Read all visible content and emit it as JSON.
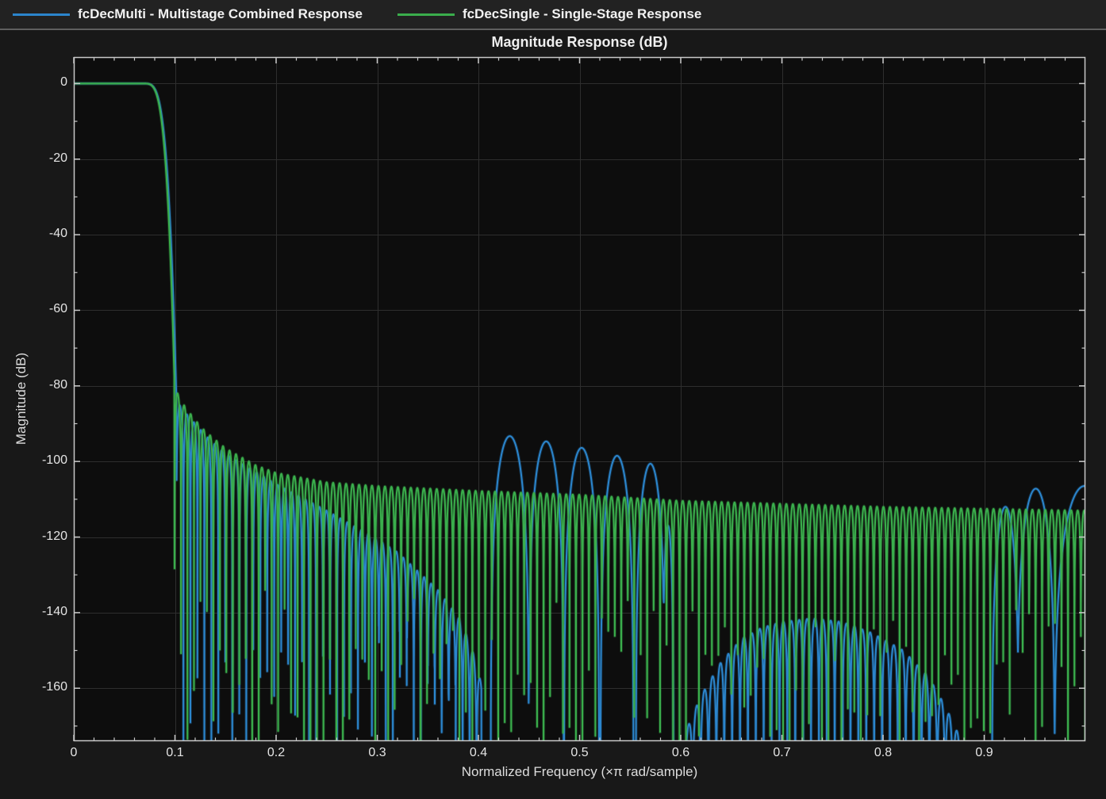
{
  "legend": {
    "items": [
      {
        "label": "fcDecMulti - Multistage Combined Response",
        "color": "#2b85cc"
      },
      {
        "label": "fcDecSingle - Single-Stage Response",
        "color": "#3aae4c"
      }
    ]
  },
  "colors": {
    "figure_bg": "#181818",
    "plot_bg": "#0d0d0d",
    "grid": "#2e2e2e",
    "axis": "#c8c8c8",
    "tick_text": "#e4e4e4",
    "title_text": "#efefef",
    "legend_bg": "#222222",
    "legend_border": "#5f5f5f",
    "legend_text": "#f2f2f2"
  },
  "chart_data": {
    "type": "line",
    "title": "Magnitude Response (dB)",
    "xlabel": "Normalized Frequency (×π rad/sample)",
    "ylabel": "Magnitude (dB)",
    "xlim": [
      0,
      1
    ],
    "ylim": [
      -174,
      7
    ],
    "xticks": [
      0,
      0.1,
      0.2,
      0.3,
      0.4,
      0.5,
      0.6,
      0.7,
      0.8,
      0.9
    ],
    "xtick_labels": [
      "0",
      "0.1",
      "0.2",
      "0.3",
      "0.4",
      "0.5",
      "0.6",
      "0.7",
      "0.8",
      "0.9"
    ],
    "yticks": [
      0,
      -20,
      -40,
      -60,
      -80,
      -100,
      -120,
      -140,
      -160
    ],
    "ytick_labels": [
      "0",
      "-20",
      "-40",
      "-60",
      "-80",
      "-100",
      "-120",
      "-140",
      "-160"
    ],
    "x_minor_step": 0.02,
    "y_minor_step": 10,
    "grid": true,
    "legend_position": "top-bar",
    "series": [
      {
        "name": "fcDecMulti - Multistage Combined Response",
        "color": "#2b85cc",
        "seed": 7,
        "model": {
          "passband": {
            "flat_db": 0,
            "flat_end": 0.068,
            "edge": 0.1015,
            "edge_db": -84,
            "shape_pow": 4
          },
          "segments": [
            {
              "type": "comb",
              "start": 0.1015,
              "end": 0.403,
              "period": 0.0069,
              "envelope": [
                [
                  0.1015,
                  -84
                ],
                [
                  0.11,
                  -87
                ],
                [
                  0.13,
                  -93
                ],
                [
                  0.15,
                  -98
                ],
                [
                  0.2,
                  -106
                ],
                [
                  0.25,
                  -113
                ],
                [
                  0.29,
                  -119
                ],
                [
                  0.32,
                  -124
                ],
                [
                  0.34,
                  -129
                ],
                [
                  0.36,
                  -134
                ],
                [
                  0.38,
                  -141
                ],
                [
                  0.393,
                  -149
                ],
                [
                  0.403,
                  -159
                ]
              ],
              "null_floor_range": [
                -140,
                -186
              ]
            },
            {
              "type": "arcs",
              "steepness": 45,
              "arcs": [
                [
                  0.431,
                  0.019,
                  -93.3
                ],
                [
                  0.467,
                  0.0175,
                  -94.7
                ],
                [
                  0.502,
                  0.0175,
                  -96.4
                ],
                [
                  0.537,
                  0.0165,
                  -98.5
                ],
                [
                  0.57,
                  0.0145,
                  -100.6
                ],
                [
                  0.5875,
                  0.0055,
                  -117
                ]
              ]
            },
            {
              "type": "comb",
              "start": 0.604,
              "end": 0.878,
              "period": 0.0078,
              "envelope": [
                [
                  0.604,
                  -172
                ],
                [
                  0.62,
                  -162
                ],
                [
                  0.64,
                  -153
                ],
                [
                  0.66,
                  -147
                ],
                [
                  0.68,
                  -144
                ],
                [
                  0.7,
                  -142.5
                ],
                [
                  0.73,
                  -141.5
                ],
                [
                  0.76,
                  -142.5
                ],
                [
                  0.79,
                  -145.5
                ],
                [
                  0.82,
                  -150
                ],
                [
                  0.845,
                  -157
                ],
                [
                  0.862,
                  -165
                ],
                [
                  0.876,
                  -173
                ]
              ],
              "null_floor_range": [
                -190,
                -190
              ]
            },
            {
              "type": "arcs",
              "steepness": 45,
              "arcs": [
                [
                  0.921,
                  0.0135,
                  -112
                ],
                [
                  0.951,
                  0.019,
                  -107.2
                ],
                [
                  0.999,
                  0.03,
                  -106.5
                ]
              ]
            }
          ]
        }
      },
      {
        "name": "fcDecSingle - Single-Stage Response",
        "color": "#3aae4c",
        "seed": 3,
        "model": {
          "passband": {
            "flat_db": 0,
            "flat_end": 0.068,
            "edge": 0.0996,
            "edge_db": -80,
            "shape_pow": 4
          },
          "segments": [
            {
              "type": "comb",
              "start": 0.0996,
              "end": 1.0,
              "period": 0.0064,
              "envelope": [
                [
                  0.0996,
                  -80
                ],
                [
                  0.105,
                  -83.5
                ],
                [
                  0.11,
                  -85.5
                ],
                [
                  0.12,
                  -89
                ],
                [
                  0.13,
                  -92
                ],
                [
                  0.15,
                  -96.5
                ],
                [
                  0.18,
                  -101
                ],
                [
                  0.2,
                  -103
                ],
                [
                  0.25,
                  -105.5
                ],
                [
                  0.3,
                  -106.5
                ],
                [
                  0.4,
                  -107.8
                ],
                [
                  0.5,
                  -108.8
                ],
                [
                  0.6,
                  -110.4
                ],
                [
                  0.7,
                  -111.2
                ],
                [
                  0.8,
                  -112
                ],
                [
                  0.9,
                  -112.5
                ],
                [
                  1.0,
                  -113
                ]
              ],
              "null_floor_range": [
                -134,
                -186
              ]
            }
          ]
        }
      }
    ]
  }
}
